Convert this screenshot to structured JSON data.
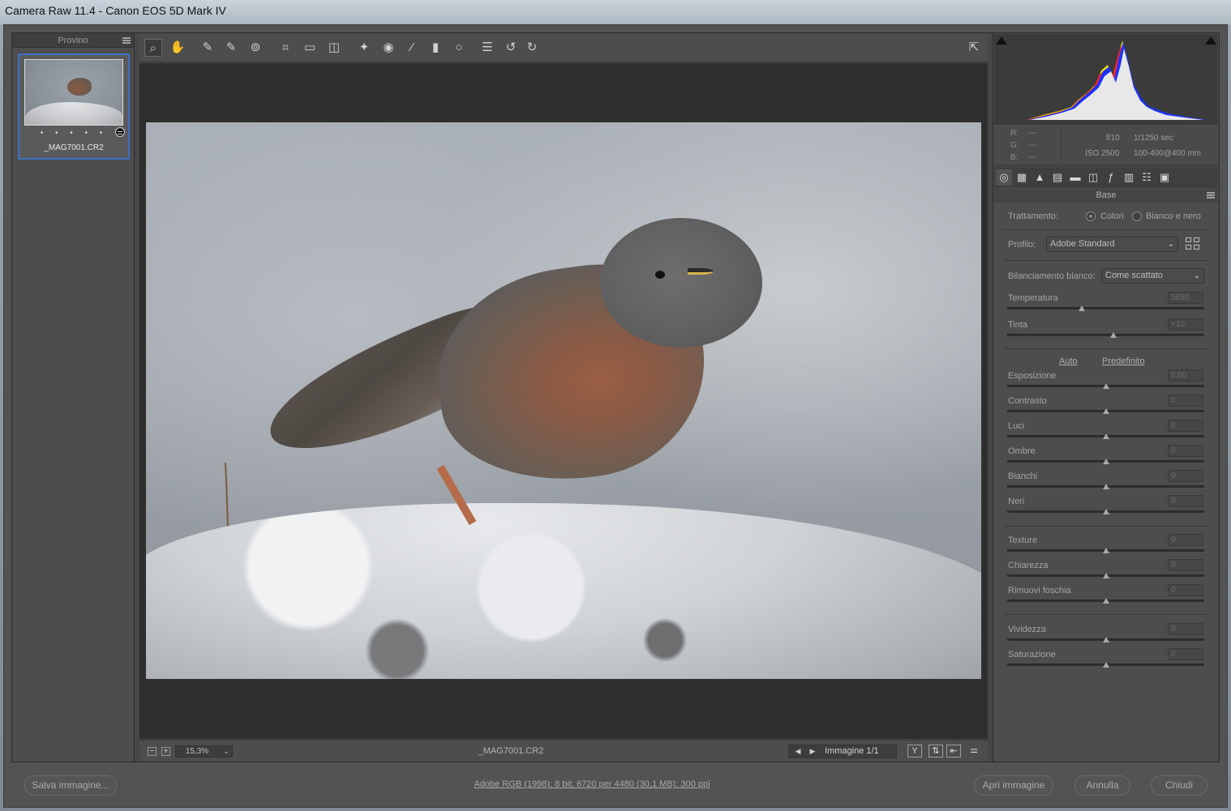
{
  "window": {
    "title": "Camera Raw 11.4  -  Canon EOS 5D Mark IV"
  },
  "filmstrip": {
    "header": "Provino",
    "items": [
      {
        "name": "_MAG7001.CR2",
        "rating_dots": "• • • • •",
        "selected": true
      }
    ]
  },
  "toolbar": {
    "tools": [
      {
        "name": "zoom-tool",
        "glyph": "⌕"
      },
      {
        "name": "hand-tool",
        "glyph": "✋"
      },
      {
        "name": "white-balance-tool",
        "glyph": "✎"
      },
      {
        "name": "color-sampler-tool",
        "glyph": "✎"
      },
      {
        "name": "targeted-adjustment-tool",
        "glyph": "⊚"
      },
      {
        "name": "crop-tool",
        "glyph": "⌗"
      },
      {
        "name": "straighten-tool",
        "glyph": "▭"
      },
      {
        "name": "transform-tool",
        "glyph": "◫"
      },
      {
        "name": "spot-removal-tool",
        "glyph": "✦"
      },
      {
        "name": "red-eye-tool",
        "glyph": "◉"
      },
      {
        "name": "adjustment-brush-tool",
        "glyph": "⁄"
      },
      {
        "name": "graduated-filter-tool",
        "glyph": "▮"
      },
      {
        "name": "radial-filter-tool",
        "glyph": "○"
      },
      {
        "name": "preferences-tool",
        "glyph": "☰"
      },
      {
        "name": "rotate-left-tool",
        "glyph": "↺"
      },
      {
        "name": "rotate-right-tool",
        "glyph": "↻"
      }
    ],
    "fullscreen_glyph": "⇱"
  },
  "canvas_status": {
    "zoom_value": "15,3%",
    "filename": "_MAG7001.CR2",
    "image_counter": "Immagine 1/1"
  },
  "info": {
    "r_label": "R:",
    "g_label": "G:",
    "b_label": "B:",
    "r_val": "---",
    "g_val": "---",
    "b_val": "---",
    "aperture": "f/10",
    "shutter": "1/1250 sec",
    "iso": "ISO 2500",
    "lens": "100-400@400 mm"
  },
  "panel": {
    "title": "Base",
    "treatment_label": "Trattamento:",
    "treatment_color": "Colori",
    "treatment_bw": "Bianco e nero",
    "profile_label": "Profilo:",
    "profile_value": "Adobe Standard",
    "wb_label": "Bilanciamento bianco:",
    "wb_value": "Come scattato",
    "auto_link": "Auto",
    "default_link": "Predefinito",
    "sliders": [
      {
        "label": "Temperatura",
        "value": "5850",
        "pos": 0.38
      },
      {
        "label": "Tinta",
        "value": "+10",
        "pos": 0.54
      },
      {
        "label": "Esposizione",
        "value": "0,00",
        "pos": 0.5
      },
      {
        "label": "Contrasto",
        "value": "0",
        "pos": 0.5
      },
      {
        "label": "Luci",
        "value": "0",
        "pos": 0.5
      },
      {
        "label": "Ombre",
        "value": "0",
        "pos": 0.5
      },
      {
        "label": "Bianchi",
        "value": "0",
        "pos": 0.5
      },
      {
        "label": "Neri",
        "value": "0",
        "pos": 0.5
      },
      {
        "label": "Texture",
        "value": "0",
        "pos": 0.5
      },
      {
        "label": "Chiarezza",
        "value": "0",
        "pos": 0.5
      },
      {
        "label": "Rimuovi foschia",
        "value": "0",
        "pos": 0.5
      },
      {
        "label": "Vividezza",
        "value": "0",
        "pos": 0.5
      },
      {
        "label": "Saturazione",
        "value": "0",
        "pos": 0.5
      }
    ]
  },
  "footer": {
    "save_button": "Salva immagine...",
    "workflow_info": "Adobe RGB (1998); 8 bit; 6720 per 4480 (30,1 MB); 300 ppi",
    "open_button": "Apri immagine",
    "cancel_button": "Annulla",
    "close_button": "Chiudi"
  }
}
